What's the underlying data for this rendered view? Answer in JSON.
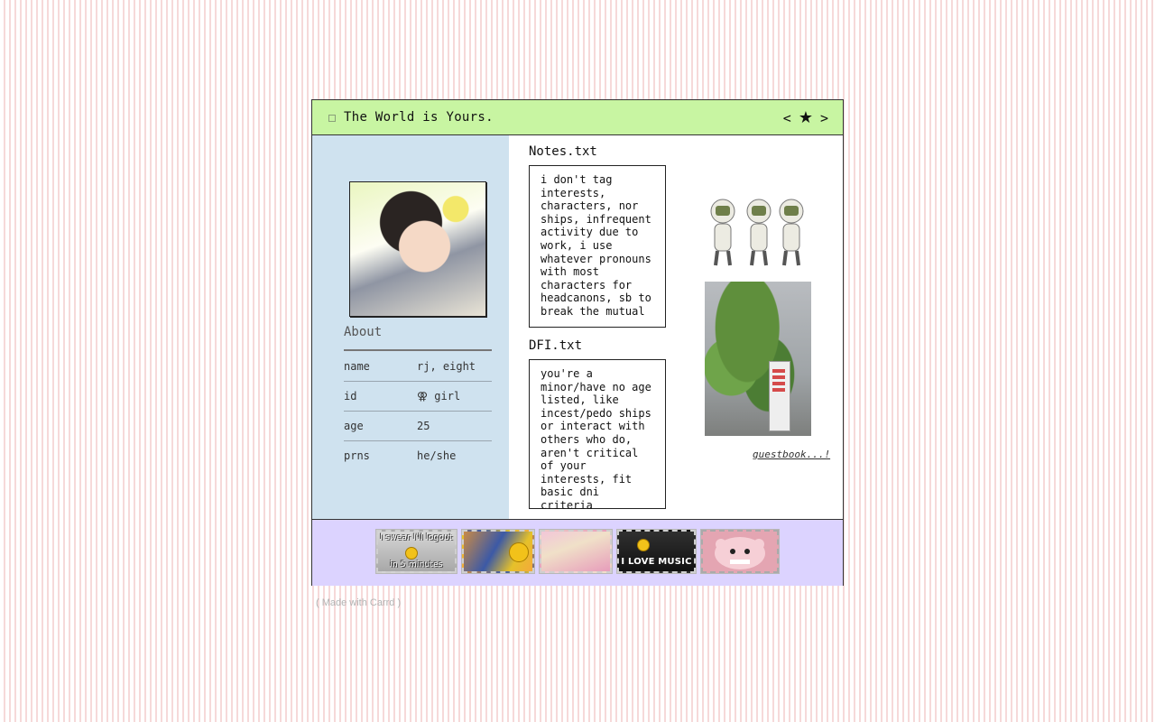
{
  "window": {
    "title": "The World is Yours.",
    "nav_prev": "<",
    "nav_star": "★",
    "nav_next": ">"
  },
  "profile": {
    "avatar_icon": "manga-character-avatar",
    "about_title": "About",
    "rows": [
      {
        "key": "name",
        "value": "rj, eight"
      },
      {
        "key": "id",
        "value": "⚢ girl"
      },
      {
        "key": "age",
        "value": "25"
      },
      {
        "key": "prns",
        "value": "he/she"
      }
    ]
  },
  "notes": {
    "title": "Notes.txt",
    "body": "i don't tag interests, characters, nor ships, infrequent activity due to work, i use whatever pronouns with most characters for headcanons, sb to break the mutual"
  },
  "dni": {
    "title": "DFI.txt",
    "body": "you're a minor/have no age listed, like incest/pedo ships or interact with others who do, aren't critical of your interests, fit basic dni criteria"
  },
  "sidebar": {
    "robots_icon": "three-robots-image",
    "photo_icon": "tree-vending-machine-photo",
    "guestbook_label": "guestbook...!"
  },
  "stamps": [
    {
      "name": "logout-stamp",
      "line1": "I swear I'll logout",
      "line2": "in 5 minutes"
    },
    {
      "name": "characters-stamp"
    },
    {
      "name": "pink-girl-stamp"
    },
    {
      "name": "music-stamp",
      "line1": "I LOVE MUSIC"
    },
    {
      "name": "pink-bear-stamp"
    }
  ],
  "footer": {
    "text": "( Made with Carrd )"
  },
  "colors": {
    "titlebar": "#c8f5a2",
    "left_panel": "#cfe2ef",
    "bottom_bar": "#dcd3ff",
    "page_stripe": "#f6d9d9"
  }
}
